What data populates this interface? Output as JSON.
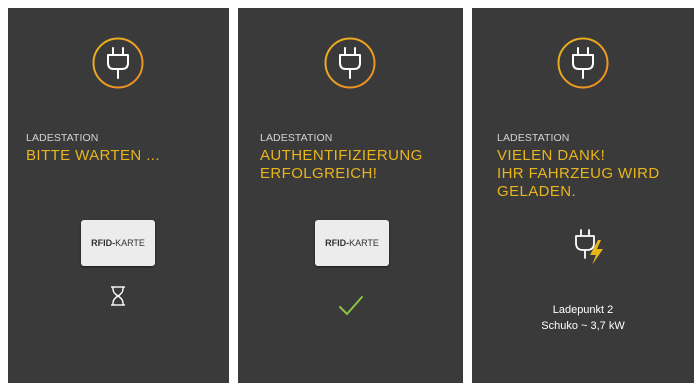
{
  "colors": {
    "accent": "#e9b51d",
    "accent_orange": "#ef8a24",
    "check_green": "#8bc43f",
    "panel": "#3a3a3a"
  },
  "screens": [
    {
      "icon": "plug-icon",
      "eyebrow": "LADESTATION",
      "headline_lines": [
        "BITTE WARTEN ..."
      ],
      "card": {
        "bold": "RFID-",
        "rest": "KARTE"
      },
      "status_icon": "hourglass-icon"
    },
    {
      "icon": "plug-icon",
      "eyebrow": "LADESTATION",
      "headline_lines": [
        "AUTHENTIFIZIERUNG",
        "ERFOLGREICH!"
      ],
      "card": {
        "bold": "RFID-",
        "rest": "KARTE"
      },
      "status_icon": "checkmark-icon"
    },
    {
      "icon": "plug-icon",
      "eyebrow": "LADESTATION",
      "headline_lines": [
        "VIELEN DANK!",
        "IHR FAHRZEUG WIRD",
        "GELADEN."
      ],
      "status_icon": "charging-plug-icon",
      "charge_point": "Ladepunkt 2",
      "socket_info": "Schuko ~ 3,7 kW"
    }
  ]
}
